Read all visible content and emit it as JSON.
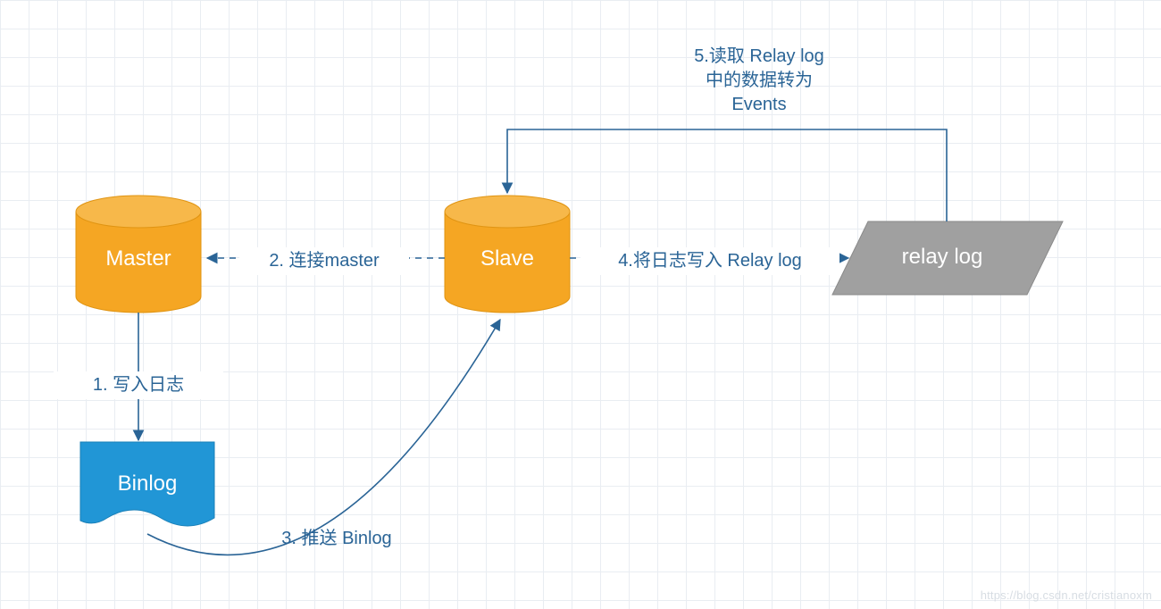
{
  "nodes": {
    "master": {
      "label": "Master"
    },
    "slave": {
      "label": "Slave"
    },
    "binlog": {
      "label": "Binlog"
    },
    "relay": {
      "label": "relay log"
    }
  },
  "edges": {
    "step1": {
      "label": "1. 写入日志"
    },
    "step2": {
      "label": "2. 连接master"
    },
    "step3": {
      "label": "3. 推送 Binlog"
    },
    "step4": {
      "label": "4.将日志写入 Relay log"
    },
    "step5": {
      "label": "5.读取 Relay log\n中的数据转为\nEvents"
    }
  },
  "colors": {
    "orange": "#f5a623",
    "orangeStroke": "#e09412",
    "blue": "#2196d6",
    "blueStroke": "#1a80b8",
    "gray": "#a0a0a0",
    "grayStroke": "#8a8a8a",
    "line": "#2a6496",
    "text": "#2a6496"
  },
  "watermark": "https://blog.csdn.net/cristianoxm"
}
